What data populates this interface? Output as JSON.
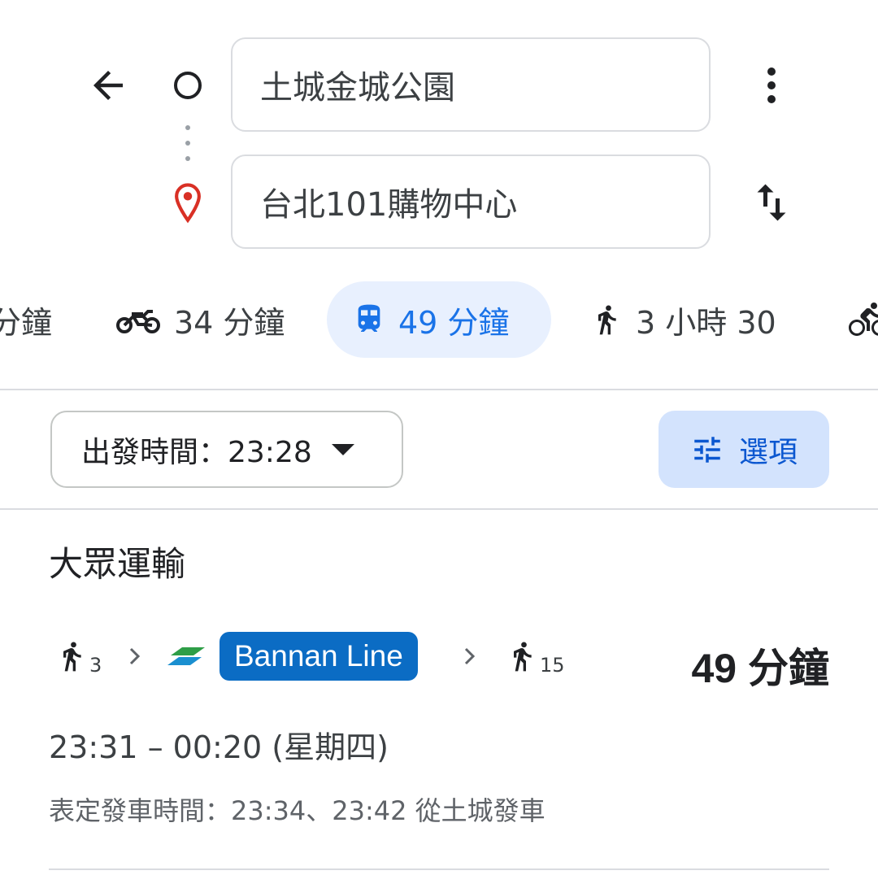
{
  "header": {
    "origin_value": "土城金城公園",
    "destination_value": "台北101購物中心"
  },
  "modes": [
    {
      "name": "car",
      "label": "分鐘",
      "selected": false
    },
    {
      "name": "motorcycle",
      "label": "34 分鐘",
      "selected": false
    },
    {
      "name": "transit",
      "label": "49 分鐘",
      "selected": true
    },
    {
      "name": "walking",
      "label": "3 小時 30",
      "selected": false
    },
    {
      "name": "bicycle",
      "label": "",
      "selected": false
    }
  ],
  "controls": {
    "depart_label": "出發時間：23:28",
    "options_label": "選項"
  },
  "section_title": "大眾運輸",
  "route": {
    "walk_start_minutes": "3",
    "line_name": "Bannan Line",
    "walk_end_minutes": "15",
    "duration": "49 分鐘",
    "time_range": "23:31 – 00:20 (星期四)",
    "schedule": "表定發車時間：23:34、23:42 從土城發車"
  },
  "colors": {
    "accent": "#1a73e8",
    "active_tab_bg": "#e8f0fe",
    "options_bg": "#d3e3fd",
    "line_badge": "#0b6cc4",
    "pin_red": "#d93025"
  },
  "icons": [
    "back-arrow-icon",
    "origin-circle-icon",
    "destination-pin-icon",
    "more-vert-icon",
    "swap-icon",
    "motorcycle-icon",
    "train-icon",
    "walking-icon",
    "bicycle-icon",
    "tune-icon",
    "dropdown-caret-icon",
    "chevron-right-icon",
    "metro-logo-icon"
  ]
}
